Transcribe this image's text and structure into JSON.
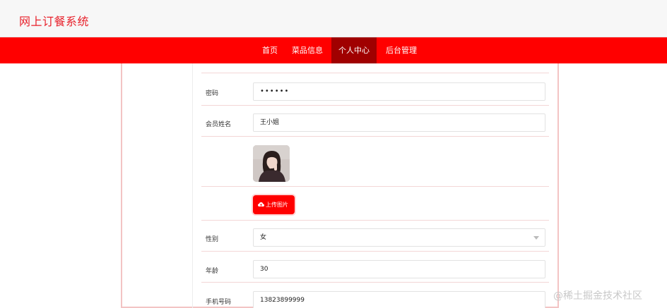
{
  "header": {
    "title": "网上订餐系统"
  },
  "nav": {
    "items": [
      {
        "label": "首页",
        "active": false
      },
      {
        "label": "菜品信息",
        "active": false
      },
      {
        "label": "个人中心",
        "active": true
      },
      {
        "label": "后台管理",
        "active": false
      }
    ]
  },
  "form": {
    "password_label": "密码",
    "password_value": "••••••",
    "name_label": "会员姓名",
    "name_value": "王小姐",
    "upload_label": "上传图片",
    "gender_label": "性别",
    "gender_value": "女",
    "age_label": "年龄",
    "age_value": "30",
    "phone_label": "手机号码",
    "phone_value": "13823899999"
  },
  "watermark": "@稀土掘金技术社区",
  "colors": {
    "brand": "#ff0000",
    "active_nav": "#a00000",
    "title": "#e8202a"
  }
}
